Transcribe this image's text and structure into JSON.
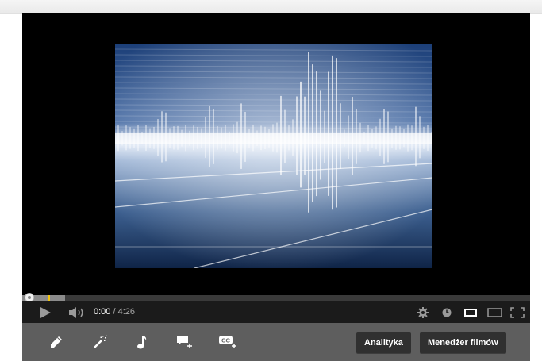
{
  "player": {
    "current_time": "0:00",
    "separator": "/",
    "duration": "4:26",
    "progress": {
      "played_fraction": 0.0,
      "loaded_fraction": 0.085
    }
  },
  "controls": {
    "left": [
      "play-icon",
      "volume-icon"
    ],
    "right": [
      "gear-icon",
      "clock-icon",
      "small-player-icon",
      "large-player-icon",
      "fullscreen-icon"
    ]
  },
  "edit_toolbar": {
    "tools": [
      "pencil-icon",
      "magic-wand-icon",
      "music-note-icon",
      "add-annotation-icon",
      "add-captions-icon"
    ],
    "analytics_label": "Analityka",
    "video_manager_label": "Menedżer filmów"
  },
  "captions_icon_text": "CC",
  "colors": {
    "progress_played": "#cc181e",
    "progress_marker": "#f1c40f",
    "controls_bg": "#1b1b1b",
    "edit_bar_bg": "#5e5e5e",
    "button_bg": "#303030"
  }
}
